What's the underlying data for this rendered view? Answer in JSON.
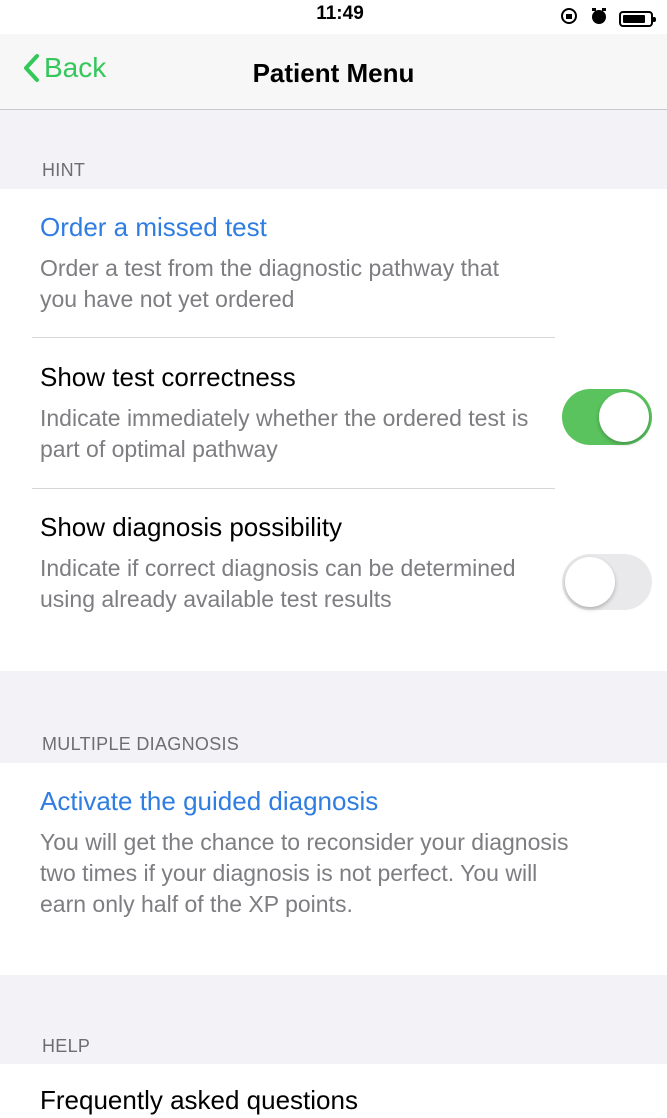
{
  "status_bar": {
    "time": "11:49",
    "icons": [
      "orientation-lock-icon",
      "alarm-icon",
      "battery-icon"
    ]
  },
  "nav": {
    "back_label": "Back",
    "title": "Patient Menu"
  },
  "colors": {
    "accent_green": "#34c759",
    "link_blue": "#2f7de1",
    "toggle_on": "#5ac35e"
  },
  "sections": {
    "hint": {
      "header": "HINT",
      "items": [
        {
          "title": "Order a missed test",
          "desc": "Order a test from the diagnostic pathway that you have not yet ordered"
        },
        {
          "title": "Show test correctness",
          "desc": "Indicate immediately whether the ordered test is part of optimal pathway",
          "toggle": true
        },
        {
          "title": "Show diagnosis possibility",
          "desc": "Indicate if correct diagnosis can be determined using already available test results",
          "toggle": false
        }
      ]
    },
    "multiple": {
      "header": "MULTIPLE DIAGNOSIS",
      "items": [
        {
          "title": "Activate the guided diagnosis",
          "desc": "You will get the chance to reconsider your diagnosis two times if your diagnosis is not perfect. You will earn only half of the XP points."
        }
      ]
    },
    "help": {
      "header": "HELP",
      "items": [
        {
          "title": "Frequently asked questions"
        }
      ]
    }
  }
}
